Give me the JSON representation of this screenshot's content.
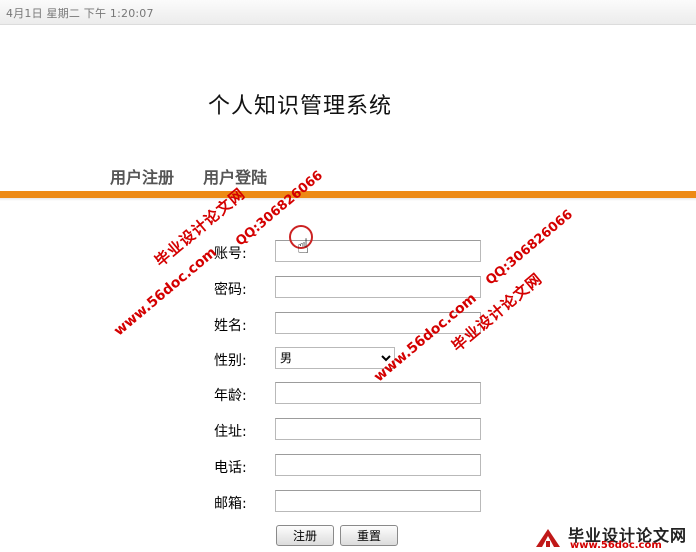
{
  "statusbar": {
    "datetime": "4月1日  星期二  下午   1:20:07"
  },
  "page": {
    "title": "个人知识管理系统"
  },
  "nav": {
    "register": "用户注册",
    "login": "用户登陆"
  },
  "form": {
    "account_label": "账号:",
    "password_label": "密码:",
    "name_label": "姓名:",
    "gender_label": "性别:",
    "gender_value": "男",
    "age_label": "年龄:",
    "address_label": "住址:",
    "phone_label": "电话:",
    "email_label": "邮箱:",
    "submit_label": "注册",
    "reset_label": "重置"
  },
  "watermarks": {
    "url": "www.56doc.com",
    "qq": "QQ:306826066",
    "cn": "毕业设计论文网"
  },
  "logo": {
    "cn": "毕业设计论文网",
    "url": "www.56doc.com",
    "color": "#d40000"
  },
  "colors": {
    "accent_bar": "#ed8a16",
    "watermark": "#d40000"
  }
}
